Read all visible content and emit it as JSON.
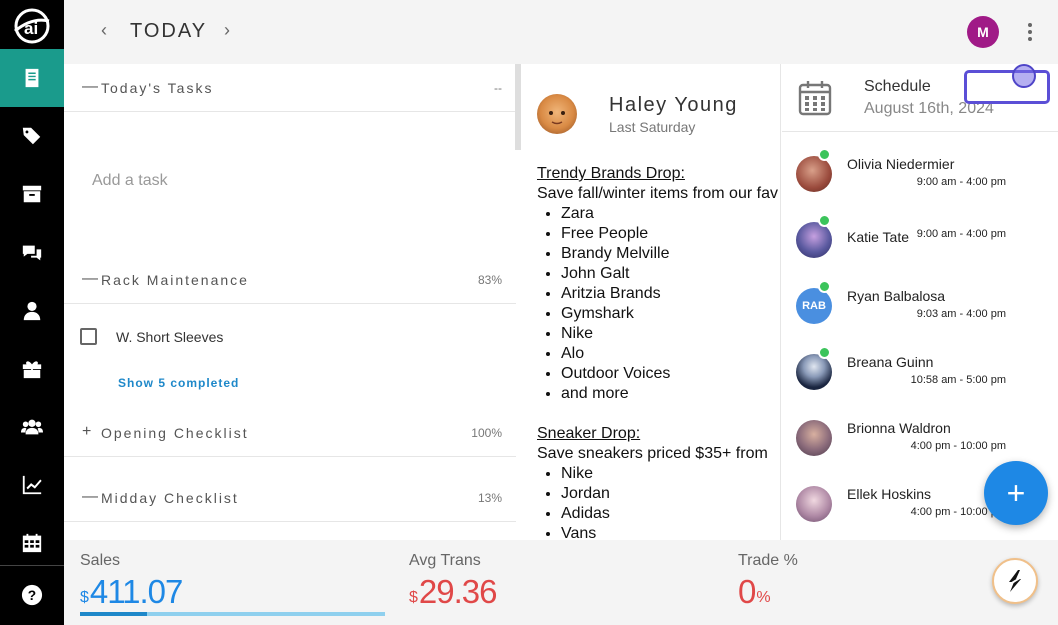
{
  "header": {
    "title": "TODAY",
    "prev_label": "‹",
    "next_label": "›",
    "avatar_initial": "M"
  },
  "sidebar": {
    "items": [
      {
        "icon": "book-icon",
        "active": true
      },
      {
        "icon": "tags-icon"
      },
      {
        "icon": "archive-icon"
      },
      {
        "icon": "chat-icon"
      },
      {
        "icon": "user-icon"
      },
      {
        "icon": "gift-icon"
      },
      {
        "icon": "users-icon"
      },
      {
        "icon": "chart-icon"
      },
      {
        "icon": "calendar-grid-icon"
      },
      {
        "icon": "help-icon"
      }
    ]
  },
  "tasks": {
    "sections": [
      {
        "toggle": "—",
        "title": "Today's Tasks",
        "pct": "--"
      },
      {
        "toggle": "—",
        "title": "Rack Maintenance",
        "pct": "83%"
      },
      {
        "toggle": "+",
        "title": "Opening Checklist",
        "pct": "100%"
      },
      {
        "toggle": "—",
        "title": "Midday Checklist",
        "pct": "13%"
      }
    ],
    "add_placeholder": "Add a task",
    "items": [
      {
        "label": "W. Short Sleeves",
        "checked": false
      }
    ],
    "show_completed": "Show 5 completed"
  },
  "post": {
    "author": "Haley Young",
    "date": "Last Saturday",
    "blocks": [
      {
        "heading": "Trendy Brands Drop:",
        "text": "Save fall/winter items from our fav",
        "items": [
          "Zara",
          "Free People",
          "Brandy Melville",
          "John Galt",
          "Aritzia Brands",
          "Gymshark",
          "Nike",
          "Alo",
          "Outdoor Voices",
          "and more"
        ]
      },
      {
        "heading": "Sneaker Drop:",
        "text": "Save sneakers priced $35+ from",
        "items": [
          "Nike",
          "Jordan",
          "Adidas",
          "Vans"
        ]
      }
    ]
  },
  "schedule": {
    "title": "Schedule",
    "date": "August 16th, 2024",
    "shifts": [
      {
        "name": "Olivia Niedermier",
        "time": "9:00 am - 4:00 pm",
        "online": true,
        "initials": "",
        "color": "#9a4a3c"
      },
      {
        "name": "Katie Tate",
        "time": "9:00 am - 4:00 pm",
        "online": true,
        "initials": "",
        "color": "#5b5aa0"
      },
      {
        "name": "Ryan Balbalosa",
        "time": "9:03 am - 4:00 pm",
        "online": true,
        "initials": "RAB",
        "color": "#4a8fe0"
      },
      {
        "name": "Breana Guinn",
        "time": "10:58 am - 5:00 pm",
        "online": true,
        "initials": "",
        "color": "#2a3a5a"
      },
      {
        "name": "Brionna Waldron",
        "time": "4:00 pm - 10:00 pm",
        "online": false,
        "initials": "",
        "color": "#8a6a7a"
      },
      {
        "name": "Ellek Hoskins",
        "time": "4:00 pm - 10:00 pm",
        "online": false,
        "initials": "",
        "color": "#b08aa6"
      }
    ]
  },
  "metrics": [
    {
      "label": "Sales",
      "prefix": "$",
      "value": "411.07",
      "suffix": "",
      "progress": 0.22
    },
    {
      "label": "Avg Trans",
      "prefix": "$",
      "value": "29.36",
      "suffix": ""
    },
    {
      "label": "Trade %",
      "prefix": "",
      "value": "0",
      "suffix": "%"
    }
  ],
  "fab": {
    "label": "+"
  },
  "colors": {
    "accent": "#1a9b8c",
    "blue": "#1e88e5",
    "red": "#e04848",
    "sidebar": "#000000"
  }
}
